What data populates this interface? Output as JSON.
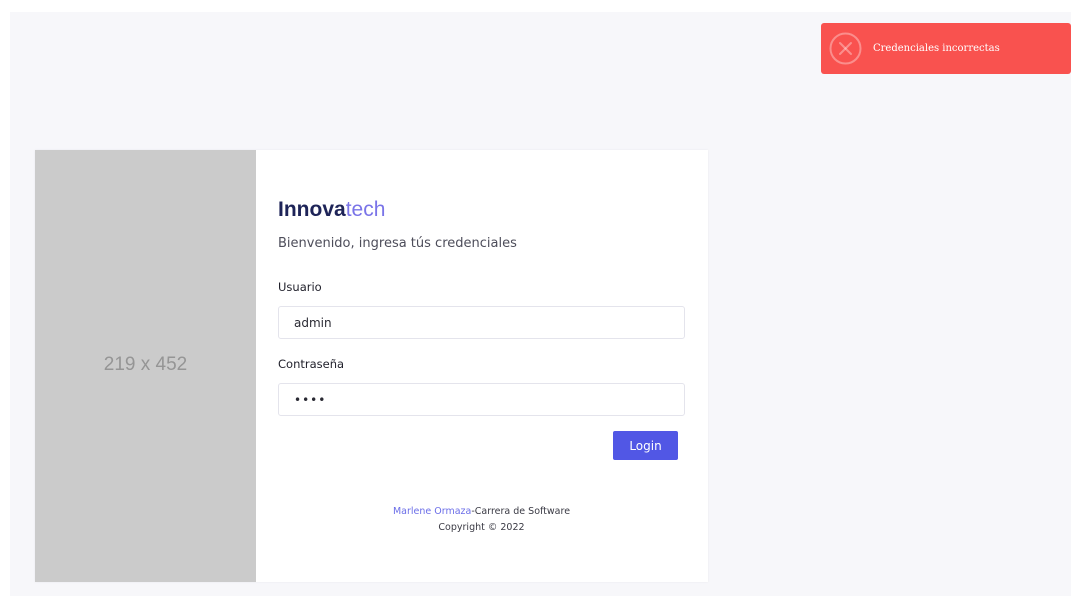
{
  "toast": {
    "message": "Credenciales incorrectas",
    "icon": "close-circle-icon",
    "color": "#f9524f"
  },
  "side_image": {
    "text": "219 x 452"
  },
  "brand": {
    "strong": "Innova",
    "light": "tech",
    "strong_color": "#1e2458",
    "light_color": "#7a74e8"
  },
  "welcome_text": "Bienvenido, ingresa tús credenciales",
  "form": {
    "user_label": "Usuario",
    "user_value": "admin",
    "password_label": "Contraseña",
    "password_value": "1234",
    "login_label": "Login",
    "accent": "#5157e5"
  },
  "footer": {
    "author": "Marlene Ormaza",
    "rest": "-Carrera de Software",
    "copyright": "Copyright © 2022"
  }
}
